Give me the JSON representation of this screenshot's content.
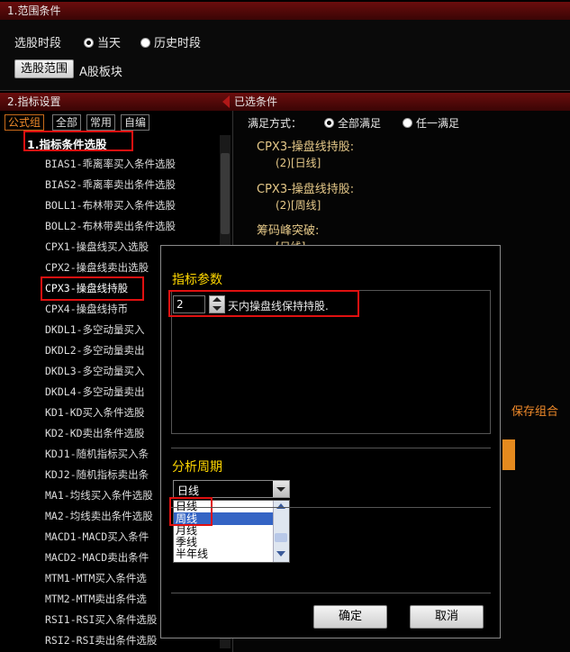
{
  "range_section": {
    "header": "1.范围条件",
    "period_label": "选股时段",
    "options": [
      "当天",
      "历史时段"
    ],
    "range_button": "选股范围",
    "range_value": "A股板块"
  },
  "indicator_section": {
    "header": "2.指标设置",
    "tabs": [
      "公式组",
      "全部",
      "常用",
      "自编"
    ],
    "group_title": "1.指标条件选股",
    "items": [
      "BIAS1-乖离率买入条件选股",
      "BIAS2-乖离率卖出条件选股",
      "BOLL1-布林带买入条件选股",
      "BOLL2-布林带卖出条件选股",
      "CPX1-操盘线买入选股",
      "CPX2-操盘线卖出选股",
      "CPX3-操盘线持股",
      "CPX4-操盘线持币",
      "DKDL1-多空动量买入",
      "DKDL2-多空动量卖出",
      "DKDL3-多空动量买入",
      "DKDL4-多空动量卖出",
      "KD1-KD买入条件选股",
      "KD2-KD卖出条件选股",
      "KDJ1-随机指标买入条",
      "KDJ2-随机指标卖出条",
      "MA1-均线买入条件选股",
      "MA2-均线卖出条件选股",
      "MACD1-MACD买入条件",
      "MACD2-MACD卖出条件",
      "MTM1-MTM买入条件选",
      "MTM2-MTM卖出条件选",
      "RSI1-RSI买入条件选股",
      "RSI2-RSI卖出条件选股"
    ]
  },
  "selected_section": {
    "header": "已选条件",
    "mode_label": "满足方式：",
    "mode_options": [
      "全部满足",
      "任一满足"
    ],
    "conditions": [
      {
        "title": "CPX3-操盘线持股:",
        "sub": "(2)[日线]"
      },
      {
        "title": "CPX3-操盘线持股:",
        "sub": "(2)[周线]"
      },
      {
        "title": "筹码峰突破:",
        "sub": "[日线]"
      }
    ],
    "save_label": "保存组合"
  },
  "dialog": {
    "param_title": "指标参数",
    "param_value": "2",
    "param_text": "天内操盘线保持持股.",
    "period_title": "分析周期",
    "period_selected": "日线",
    "period_options": [
      "日线",
      "周线",
      "月线",
      "季线",
      "半年线"
    ],
    "ok_label": "确定",
    "cancel_label": "取消"
  },
  "colors": {
    "header_bg": "#5a0a0a",
    "accent_orange": "#f08a2a",
    "condition_text": "#e6c989",
    "highlight_red": "#e01010",
    "dialog_title": "#ffd700"
  }
}
